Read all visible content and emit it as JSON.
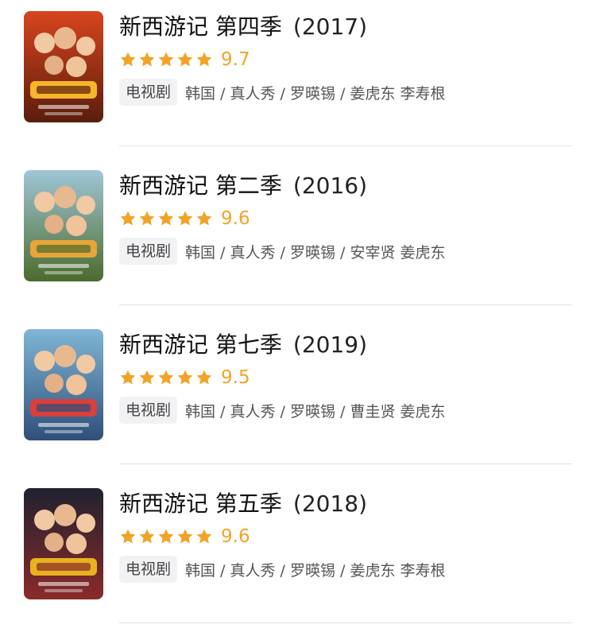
{
  "items": [
    {
      "title": "新西游记 第四季",
      "year": "(2017)",
      "score": "9.7",
      "tag": "电视剧",
      "meta": "韩国 / 真人秀 / 罗暎锡 / 姜虎东 李寿根",
      "stars": 5,
      "poster_colors": [
        "#d7451e",
        "#f7b52b",
        "#5a1d0c"
      ]
    },
    {
      "title": "新西游记 第二季",
      "year": "(2016)",
      "score": "9.6",
      "tag": "电视剧",
      "meta": "韩国 / 真人秀 / 罗暎锡 / 安宰贤 姜虎东",
      "stars": 5,
      "poster_colors": [
        "#9fc6d8",
        "#e7a53a",
        "#4c6b2c"
      ]
    },
    {
      "title": "新西游记 第七季",
      "year": "(2019)",
      "score": "9.5",
      "tag": "电视剧",
      "meta": "韩国 / 真人秀 / 罗暎锡 / 曹圭贤 姜虎东",
      "stars": 5,
      "poster_colors": [
        "#7fb6d6",
        "#d8403b",
        "#2f4f7a"
      ]
    },
    {
      "title": "新西游记 第五季",
      "year": "(2018)",
      "score": "9.6",
      "tag": "电视剧",
      "meta": "韩国 / 真人秀 / 罗暎锡 / 姜虎东 李寿根",
      "stars": 5,
      "poster_colors": [
        "#1f2230",
        "#e9b21f",
        "#8a2a2a"
      ]
    }
  ],
  "colors": {
    "star": "#f2a327",
    "score": "#f2a327",
    "divider": "#e1e1e1"
  }
}
